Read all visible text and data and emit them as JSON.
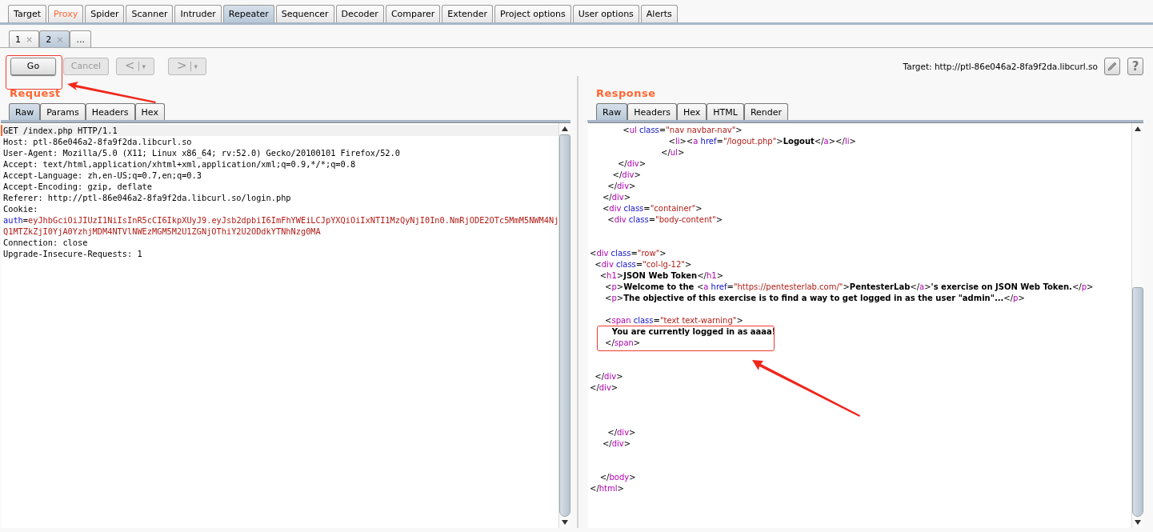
{
  "main_tabs": [
    {
      "label": "Target",
      "selected": false,
      "highlighted": false
    },
    {
      "label": "Proxy",
      "selected": false,
      "highlighted": true
    },
    {
      "label": "Spider",
      "selected": false,
      "highlighted": false
    },
    {
      "label": "Scanner",
      "selected": false,
      "highlighted": false
    },
    {
      "label": "Intruder",
      "selected": false,
      "highlighted": false
    },
    {
      "label": "Repeater",
      "selected": true,
      "highlighted": false
    },
    {
      "label": "Sequencer",
      "selected": false,
      "highlighted": false
    },
    {
      "label": "Decoder",
      "selected": false,
      "highlighted": false
    },
    {
      "label": "Comparer",
      "selected": false,
      "highlighted": false
    },
    {
      "label": "Extender",
      "selected": false,
      "highlighted": false
    },
    {
      "label": "Project options",
      "selected": false,
      "highlighted": false
    },
    {
      "label": "User options",
      "selected": false,
      "highlighted": false
    },
    {
      "label": "Alerts",
      "selected": false,
      "highlighted": false
    }
  ],
  "repeater_tabs": [
    {
      "label": "1",
      "close": "×",
      "selected": false
    },
    {
      "label": "2",
      "close": "×",
      "selected": true
    },
    {
      "label": "...",
      "selected": false
    }
  ],
  "toolbar": {
    "go": {
      "label": "Go",
      "disabled": false
    },
    "cancel": {
      "label": "Cancel",
      "disabled": true
    },
    "back": {
      "label": "<",
      "caret": "▾",
      "disabled": true
    },
    "forward": {
      "label": ">",
      "caret": "▾",
      "disabled": true
    },
    "target": "Target: http://ptl-86e046a2-8fa9f2da.libcurl.so",
    "help": "?"
  },
  "request": {
    "title": "Request",
    "tabs": [
      {
        "label": "Raw",
        "selected": true
      },
      {
        "label": "Params",
        "selected": false
      },
      {
        "label": "Headers",
        "selected": false
      },
      {
        "label": "Hex",
        "selected": false
      }
    ],
    "lines": [
      [
        {
          "kind": "txt",
          "text": "GET /index.php HTTP/1.1"
        }
      ],
      [
        {
          "kind": "txt",
          "text": "Host: ptl-86e046a2-8fa9f2da.libcurl.so"
        }
      ],
      [
        {
          "kind": "txt",
          "text": "User-Agent: Mozilla/5.0 (X11; Linux x86_64; rv:52.0) Gecko/20100101 Firefox/52.0"
        }
      ],
      [
        {
          "kind": "txt",
          "text": "Accept: text/html,application/xhtml+xml,application/xml;q=0.9,*/*;q=0.8"
        }
      ],
      [
        {
          "kind": "txt",
          "text": "Accept-Language: zh,en-US;q=0.7,en;q=0.3"
        }
      ],
      [
        {
          "kind": "txt",
          "text": "Accept-Encoding: gzip, deflate"
        }
      ],
      [
        {
          "kind": "txt",
          "text": "Referer: http://ptl-86e046a2-8fa9f2da.libcurl.so/login.php"
        }
      ],
      [
        {
          "kind": "txt",
          "text": "Cookie:"
        }
      ],
      [
        {
          "kind": "attr",
          "text": "auth"
        },
        {
          "kind": "txt",
          "text": "="
        },
        {
          "kind": "val",
          "text": "eyJhbGciOiJIUzI1NiIsInR5cCI6IkpXUyJ9.eyJsb2dpbiI6ImFhYWEiLCJpYXQiOiIxNTI1MzQyNjI0In0.NmRjODE2OTc5MmM5NWM4Nj"
        }
      ],
      [
        {
          "kind": "val",
          "text": "Q1MTZkZjI0YjA0YzhjMDM4NTVlNWEzMGM5M2U1ZGNjOThiY2U2ODdkYTNhNzg0MA"
        }
      ],
      [
        {
          "kind": "txt",
          "text": "Connection: close"
        }
      ],
      [
        {
          "kind": "txt",
          "text": "Upgrade-Insecure-Requests: 1"
        }
      ]
    ]
  },
  "response": {
    "title": "Response",
    "tabs": [
      {
        "label": "Raw",
        "selected": true
      },
      {
        "label": "Headers",
        "selected": false
      },
      {
        "label": "Hex",
        "selected": false
      },
      {
        "label": "HTML",
        "selected": false
      },
      {
        "label": "Render",
        "selected": false
      }
    ],
    "lines": [
      [
        {
          "kind": "p",
          "text": "             <"
        },
        {
          "kind": "tag",
          "text": "ul"
        },
        {
          "kind": "attr",
          "text": " class"
        },
        {
          "kind": "p",
          "text": "="
        },
        {
          "kind": "val",
          "text": "\"nav navbar-nav\""
        },
        {
          "kind": "p",
          "text": ">"
        }
      ],
      [
        {
          "kind": "p",
          "text": "                               <"
        },
        {
          "kind": "tag",
          "text": "li"
        },
        {
          "kind": "p",
          "text": "><"
        },
        {
          "kind": "tag",
          "text": "a"
        },
        {
          "kind": "attr",
          "text": " href"
        },
        {
          "kind": "p",
          "text": "="
        },
        {
          "kind": "val",
          "text": "\"/logout.php\""
        },
        {
          "kind": "p",
          "text": ">"
        },
        {
          "kind": "txt",
          "text": "Logout"
        },
        {
          "kind": "p",
          "text": "</"
        },
        {
          "kind": "tag",
          "text": "a"
        },
        {
          "kind": "p",
          "text": "></"
        },
        {
          "kind": "tag",
          "text": "li"
        },
        {
          "kind": "p",
          "text": ">"
        }
      ],
      [
        {
          "kind": "p",
          "text": "                            </"
        },
        {
          "kind": "tag",
          "text": "ul"
        },
        {
          "kind": "p",
          "text": ">"
        }
      ],
      [
        {
          "kind": "p",
          "text": "           </"
        },
        {
          "kind": "tag",
          "text": "div"
        },
        {
          "kind": "p",
          "text": ">"
        }
      ],
      [
        {
          "kind": "p",
          "text": "         </"
        },
        {
          "kind": "tag",
          "text": "div"
        },
        {
          "kind": "p",
          "text": ">"
        }
      ],
      [
        {
          "kind": "p",
          "text": "       </"
        },
        {
          "kind": "tag",
          "text": "div"
        },
        {
          "kind": "p",
          "text": ">"
        }
      ],
      [
        {
          "kind": "p",
          "text": "     </"
        },
        {
          "kind": "tag",
          "text": "div"
        },
        {
          "kind": "p",
          "text": ">"
        }
      ],
      [
        {
          "kind": "p",
          "text": "     <"
        },
        {
          "kind": "tag",
          "text": "div"
        },
        {
          "kind": "attr",
          "text": " class"
        },
        {
          "kind": "p",
          "text": "="
        },
        {
          "kind": "val",
          "text": "\"container\""
        },
        {
          "kind": "p",
          "text": ">"
        }
      ],
      [
        {
          "kind": "p",
          "text": "       <"
        },
        {
          "kind": "tag",
          "text": "div"
        },
        {
          "kind": "attr",
          "text": " class"
        },
        {
          "kind": "p",
          "text": "="
        },
        {
          "kind": "val",
          "text": "\"body-content\""
        },
        {
          "kind": "p",
          "text": ">"
        }
      ],
      {
        "kind": "blank"
      },
      {
        "kind": "blank"
      },
      [
        {
          "kind": "p",
          "text": "<"
        },
        {
          "kind": "tag",
          "text": "div"
        },
        {
          "kind": "attr",
          "text": " class"
        },
        {
          "kind": "p",
          "text": "="
        },
        {
          "kind": "val",
          "text": "\"row\""
        },
        {
          "kind": "p",
          "text": ">"
        }
      ],
      [
        {
          "kind": "p",
          "text": "  <"
        },
        {
          "kind": "tag",
          "text": "div"
        },
        {
          "kind": "attr",
          "text": " class"
        },
        {
          "kind": "p",
          "text": "="
        },
        {
          "kind": "val",
          "text": "\"col-lg-12\""
        },
        {
          "kind": "p",
          "text": ">"
        }
      ],
      [
        {
          "kind": "p",
          "text": "    <"
        },
        {
          "kind": "tag",
          "text": "h1"
        },
        {
          "kind": "p",
          "text": ">"
        },
        {
          "kind": "txt",
          "text": "JSON Web Token"
        },
        {
          "kind": "p",
          "text": "</"
        },
        {
          "kind": "tag",
          "text": "h1"
        },
        {
          "kind": "p",
          "text": ">"
        }
      ],
      [
        {
          "kind": "p",
          "text": "      <"
        },
        {
          "kind": "tag",
          "text": "p"
        },
        {
          "kind": "p",
          "text": ">"
        },
        {
          "kind": "txt",
          "text": "Welcome to the "
        },
        {
          "kind": "p",
          "text": "<"
        },
        {
          "kind": "tag",
          "text": "a"
        },
        {
          "kind": "attr",
          "text": " href"
        },
        {
          "kind": "p",
          "text": "="
        },
        {
          "kind": "val",
          "text": "\"https://pentesterlab.com/\""
        },
        {
          "kind": "p",
          "text": ">"
        },
        {
          "kind": "txt",
          "text": "PentesterLab"
        },
        {
          "kind": "p",
          "text": "</"
        },
        {
          "kind": "tag",
          "text": "a"
        },
        {
          "kind": "p",
          "text": ">"
        },
        {
          "kind": "txt",
          "text": "'s exercise on JSON Web Token."
        },
        {
          "kind": "p",
          "text": "</"
        },
        {
          "kind": "tag",
          "text": "p"
        },
        {
          "kind": "p",
          "text": ">"
        }
      ],
      [
        {
          "kind": "p",
          "text": "      <"
        },
        {
          "kind": "tag",
          "text": "p"
        },
        {
          "kind": "p",
          "text": ">"
        },
        {
          "kind": "txt",
          "text": "The objective of this exercise is to find a way to get logged in as the user \"admin\"..."
        },
        {
          "kind": "p",
          "text": "</"
        },
        {
          "kind": "tag",
          "text": "p"
        },
        {
          "kind": "p",
          "text": ">"
        }
      ],
      {
        "kind": "blank"
      },
      [
        {
          "kind": "p",
          "text": "      <"
        },
        {
          "kind": "tag",
          "text": "span"
        },
        {
          "kind": "attr",
          "text": " class"
        },
        {
          "kind": "p",
          "text": "="
        },
        {
          "kind": "val",
          "text": "\"text text-warning\""
        },
        {
          "kind": "p",
          "text": ">"
        }
      ],
      [
        {
          "kind": "txt",
          "text": "        You are currently logged in as aaaa!"
        }
      ],
      [
        {
          "kind": "p",
          "text": "      </"
        },
        {
          "kind": "tag",
          "text": "span"
        },
        {
          "kind": "p",
          "text": ">"
        }
      ],
      {
        "kind": "blank"
      },
      {
        "kind": "blank"
      },
      [
        {
          "kind": "p",
          "text": "  </"
        },
        {
          "kind": "tag",
          "text": "div"
        },
        {
          "kind": "p",
          "text": ">"
        }
      ],
      [
        {
          "kind": "p",
          "text": "</"
        },
        {
          "kind": "tag",
          "text": "div"
        },
        {
          "kind": "p",
          "text": ">"
        }
      ],
      {
        "kind": "blank"
      },
      {
        "kind": "blank"
      },
      {
        "kind": "blank"
      },
      [
        {
          "kind": "p",
          "text": "       </"
        },
        {
          "kind": "tag",
          "text": "div"
        },
        {
          "kind": "p",
          "text": ">"
        }
      ],
      [
        {
          "kind": "p",
          "text": "     </"
        },
        {
          "kind": "tag",
          "text": "div"
        },
        {
          "kind": "p",
          "text": ">"
        }
      ],
      {
        "kind": "blank"
      },
      {
        "kind": "blank"
      },
      [
        {
          "kind": "p",
          "text": "    </"
        },
        {
          "kind": "tag",
          "text": "body"
        },
        {
          "kind": "p",
          "text": ">"
        }
      ],
      [
        {
          "kind": "p",
          "text": "</"
        },
        {
          "kind": "tag",
          "text": "html"
        },
        {
          "kind": "p",
          "text": ">"
        }
      ]
    ]
  }
}
